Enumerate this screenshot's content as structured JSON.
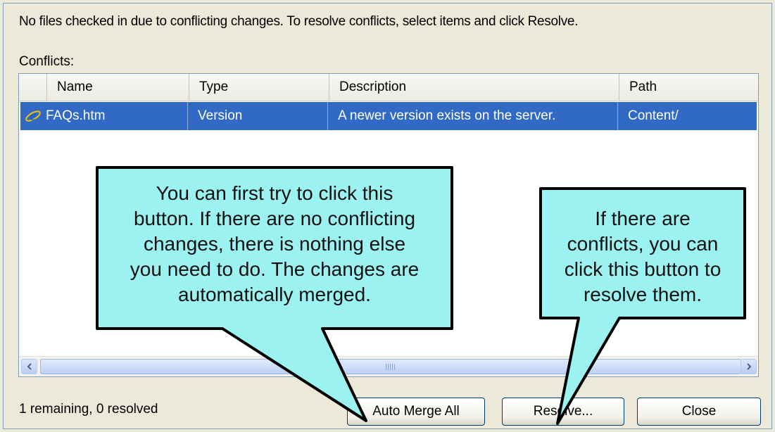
{
  "dialog": {
    "message": "No files checked in due to conflicting changes.  To resolve conflicts, select items and click Resolve.",
    "conflicts_label": "Conflicts:"
  },
  "table": {
    "columns": [
      "Name",
      "Type",
      "Description",
      "Path"
    ],
    "rows": [
      {
        "icon": "internet-explorer-icon",
        "name": "FAQs.htm",
        "type": "Version",
        "description": "A newer version exists on the server.",
        "path": "Content/",
        "selected": true
      }
    ]
  },
  "status_text": "1 remaining, 0 resolved",
  "buttons": {
    "auto_merge": "Auto Merge All",
    "resolve": "Resolve...",
    "close": "Close"
  },
  "callouts": {
    "left": [
      "You can first try to click this",
      "button. If there are no conflicting",
      "changes, there is nothing else",
      "you need to do. The changes are",
      "automatically merged."
    ],
    "right": [
      "If there are",
      "conflicts, you can",
      "click this button to",
      "resolve them."
    ]
  },
  "colors": {
    "selection": "#316ac5",
    "callout_fill": "#9cf2f0",
    "dialog_bg": "#ece9d8"
  }
}
